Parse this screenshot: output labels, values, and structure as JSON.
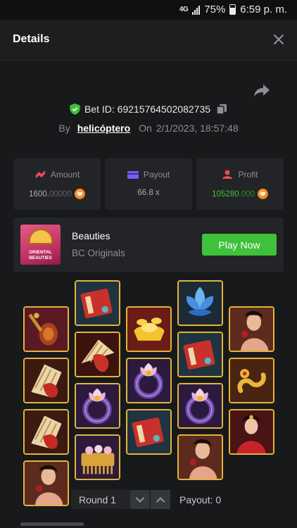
{
  "status_bar": {
    "network": "4G",
    "battery": "75%",
    "time": "6:59 p. m."
  },
  "header": {
    "title": "Details"
  },
  "bet": {
    "id_label": "Bet ID: 69215764502082735",
    "by_label": "By",
    "user": "helicóptero",
    "on_label": "On",
    "date": "2/1/2023, 18:57:48"
  },
  "stats": {
    "amount": {
      "label": "Amount",
      "value_main": "1600.",
      "value_dim": "00000"
    },
    "payout": {
      "label": "Payout",
      "value": "66.8 x"
    },
    "profit": {
      "label": "Profit",
      "value_main": "105280.",
      "value_dim": "000"
    }
  },
  "game": {
    "name": "Beauties",
    "provider": "BC Originals",
    "thumb_line1": "ORIENTAL",
    "thumb_line2": "BEAUTIES",
    "play_label": "Play Now"
  },
  "reels": {
    "symbols": [
      [
        "pipa",
        "scroll-fan",
        "scroll-fan",
        "lady-rose"
      ],
      [
        "red-book",
        "fan",
        "lotus-ring",
        "comb"
      ],
      [
        "gold-ingot",
        "lotus-ring",
        "red-book"
      ],
      [
        "blue-lotus",
        "red-book",
        "lotus-ring",
        "lady-rose"
      ],
      [
        "lady-rose",
        "jade-pendant",
        "lady-red"
      ]
    ]
  },
  "controls": {
    "round": "Round 1",
    "payout": "Payout: 0"
  },
  "colors": {
    "accent_green": "#3fc13b",
    "profit_green": "#43c233",
    "tile_border": "#e2b53a",
    "background": "#18191b"
  }
}
